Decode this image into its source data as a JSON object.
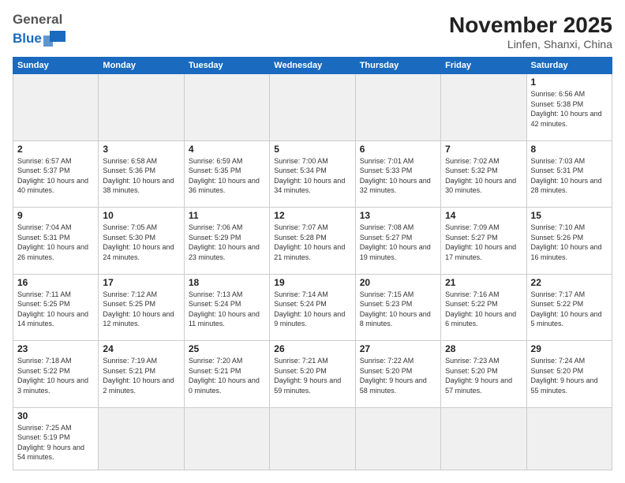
{
  "header": {
    "logo_general": "General",
    "logo_blue": "Blue",
    "month_title": "November 2025",
    "location": "Linfen, Shanxi, China"
  },
  "days_of_week": [
    "Sunday",
    "Monday",
    "Tuesday",
    "Wednesday",
    "Thursday",
    "Friday",
    "Saturday"
  ],
  "weeks": [
    [
      null,
      null,
      null,
      null,
      null,
      null,
      {
        "day": 1,
        "sunrise": "6:56 AM",
        "sunset": "5:38 PM",
        "daylight": "10 hours and 42 minutes."
      }
    ],
    [
      {
        "day": 2,
        "sunrise": "6:57 AM",
        "sunset": "5:37 PM",
        "daylight": "10 hours and 40 minutes."
      },
      {
        "day": 3,
        "sunrise": "6:58 AM",
        "sunset": "5:36 PM",
        "daylight": "10 hours and 38 minutes."
      },
      {
        "day": 4,
        "sunrise": "6:59 AM",
        "sunset": "5:35 PM",
        "daylight": "10 hours and 36 minutes."
      },
      {
        "day": 5,
        "sunrise": "7:00 AM",
        "sunset": "5:34 PM",
        "daylight": "10 hours and 34 minutes."
      },
      {
        "day": 6,
        "sunrise": "7:01 AM",
        "sunset": "5:33 PM",
        "daylight": "10 hours and 32 minutes."
      },
      {
        "day": 7,
        "sunrise": "7:02 AM",
        "sunset": "5:32 PM",
        "daylight": "10 hours and 30 minutes."
      },
      {
        "day": 8,
        "sunrise": "7:03 AM",
        "sunset": "5:31 PM",
        "daylight": "10 hours and 28 minutes."
      }
    ],
    [
      {
        "day": 9,
        "sunrise": "7:04 AM",
        "sunset": "5:31 PM",
        "daylight": "10 hours and 26 minutes."
      },
      {
        "day": 10,
        "sunrise": "7:05 AM",
        "sunset": "5:30 PM",
        "daylight": "10 hours and 24 minutes."
      },
      {
        "day": 11,
        "sunrise": "7:06 AM",
        "sunset": "5:29 PM",
        "daylight": "10 hours and 23 minutes."
      },
      {
        "day": 12,
        "sunrise": "7:07 AM",
        "sunset": "5:28 PM",
        "daylight": "10 hours and 21 minutes."
      },
      {
        "day": 13,
        "sunrise": "7:08 AM",
        "sunset": "5:27 PM",
        "daylight": "10 hours and 19 minutes."
      },
      {
        "day": 14,
        "sunrise": "7:09 AM",
        "sunset": "5:27 PM",
        "daylight": "10 hours and 17 minutes."
      },
      {
        "day": 15,
        "sunrise": "7:10 AM",
        "sunset": "5:26 PM",
        "daylight": "10 hours and 16 minutes."
      }
    ],
    [
      {
        "day": 16,
        "sunrise": "7:11 AM",
        "sunset": "5:25 PM",
        "daylight": "10 hours and 14 minutes."
      },
      {
        "day": 17,
        "sunrise": "7:12 AM",
        "sunset": "5:25 PM",
        "daylight": "10 hours and 12 minutes."
      },
      {
        "day": 18,
        "sunrise": "7:13 AM",
        "sunset": "5:24 PM",
        "daylight": "10 hours and 11 minutes."
      },
      {
        "day": 19,
        "sunrise": "7:14 AM",
        "sunset": "5:24 PM",
        "daylight": "10 hours and 9 minutes."
      },
      {
        "day": 20,
        "sunrise": "7:15 AM",
        "sunset": "5:23 PM",
        "daylight": "10 hours and 8 minutes."
      },
      {
        "day": 21,
        "sunrise": "7:16 AM",
        "sunset": "5:22 PM",
        "daylight": "10 hours and 6 minutes."
      },
      {
        "day": 22,
        "sunrise": "7:17 AM",
        "sunset": "5:22 PM",
        "daylight": "10 hours and 5 minutes."
      }
    ],
    [
      {
        "day": 23,
        "sunrise": "7:18 AM",
        "sunset": "5:22 PM",
        "daylight": "10 hours and 3 minutes."
      },
      {
        "day": 24,
        "sunrise": "7:19 AM",
        "sunset": "5:21 PM",
        "daylight": "10 hours and 2 minutes."
      },
      {
        "day": 25,
        "sunrise": "7:20 AM",
        "sunset": "5:21 PM",
        "daylight": "10 hours and 0 minutes."
      },
      {
        "day": 26,
        "sunrise": "7:21 AM",
        "sunset": "5:20 PM",
        "daylight": "9 hours and 59 minutes."
      },
      {
        "day": 27,
        "sunrise": "7:22 AM",
        "sunset": "5:20 PM",
        "daylight": "9 hours and 58 minutes."
      },
      {
        "day": 28,
        "sunrise": "7:23 AM",
        "sunset": "5:20 PM",
        "daylight": "9 hours and 57 minutes."
      },
      {
        "day": 29,
        "sunrise": "7:24 AM",
        "sunset": "5:20 PM",
        "daylight": "9 hours and 55 minutes."
      }
    ],
    [
      {
        "day": 30,
        "sunrise": "7:25 AM",
        "sunset": "5:19 PM",
        "daylight": "9 hours and 54 minutes."
      },
      null,
      null,
      null,
      null,
      null,
      null
    ]
  ]
}
